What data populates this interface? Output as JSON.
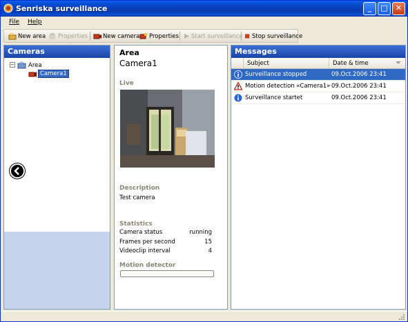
{
  "window": {
    "title": "Senriska surveillance"
  },
  "menu": {
    "file": "File",
    "help": "Help"
  },
  "toolbar": {
    "new_area": "New area",
    "properties1": "Properties",
    "new_camera": "New camera",
    "properties2": "Properties",
    "start": "Start surveillance",
    "stop": "Stop surveillance"
  },
  "cameras": {
    "title": "Cameras",
    "tree": {
      "root": "Area",
      "child": "Camera1"
    }
  },
  "details": {
    "area_label": "Area",
    "camera_name": "Camera1",
    "live_label": "Live",
    "description_label": "Description",
    "description": "Test camera",
    "statistics_label": "Statistics",
    "stats": [
      {
        "name": "Camera status",
        "value": "running"
      },
      {
        "name": "Frames per second",
        "value": "15"
      },
      {
        "name": "Videoclip interval",
        "value": "4"
      }
    ],
    "motion_label": "Motion detector"
  },
  "messages": {
    "title": "Messages",
    "col_subject": "Subject",
    "col_date": "Date & time",
    "rows": [
      {
        "icon": "info-icon",
        "subject": "Surveillance stopped",
        "date": "09.Oct.2006 23:41"
      },
      {
        "icon": "warning-icon",
        "subject": "Motion detection «Camera1»",
        "date": "09.Oct.2006 23:41"
      },
      {
        "icon": "info-icon",
        "subject": "Surveillance startet",
        "date": "09.Oct.2006 23:41"
      }
    ]
  },
  "colors": {
    "titlebar": "#0842c2",
    "panel_header": "#1a46a8",
    "selection": "#316ac5"
  }
}
